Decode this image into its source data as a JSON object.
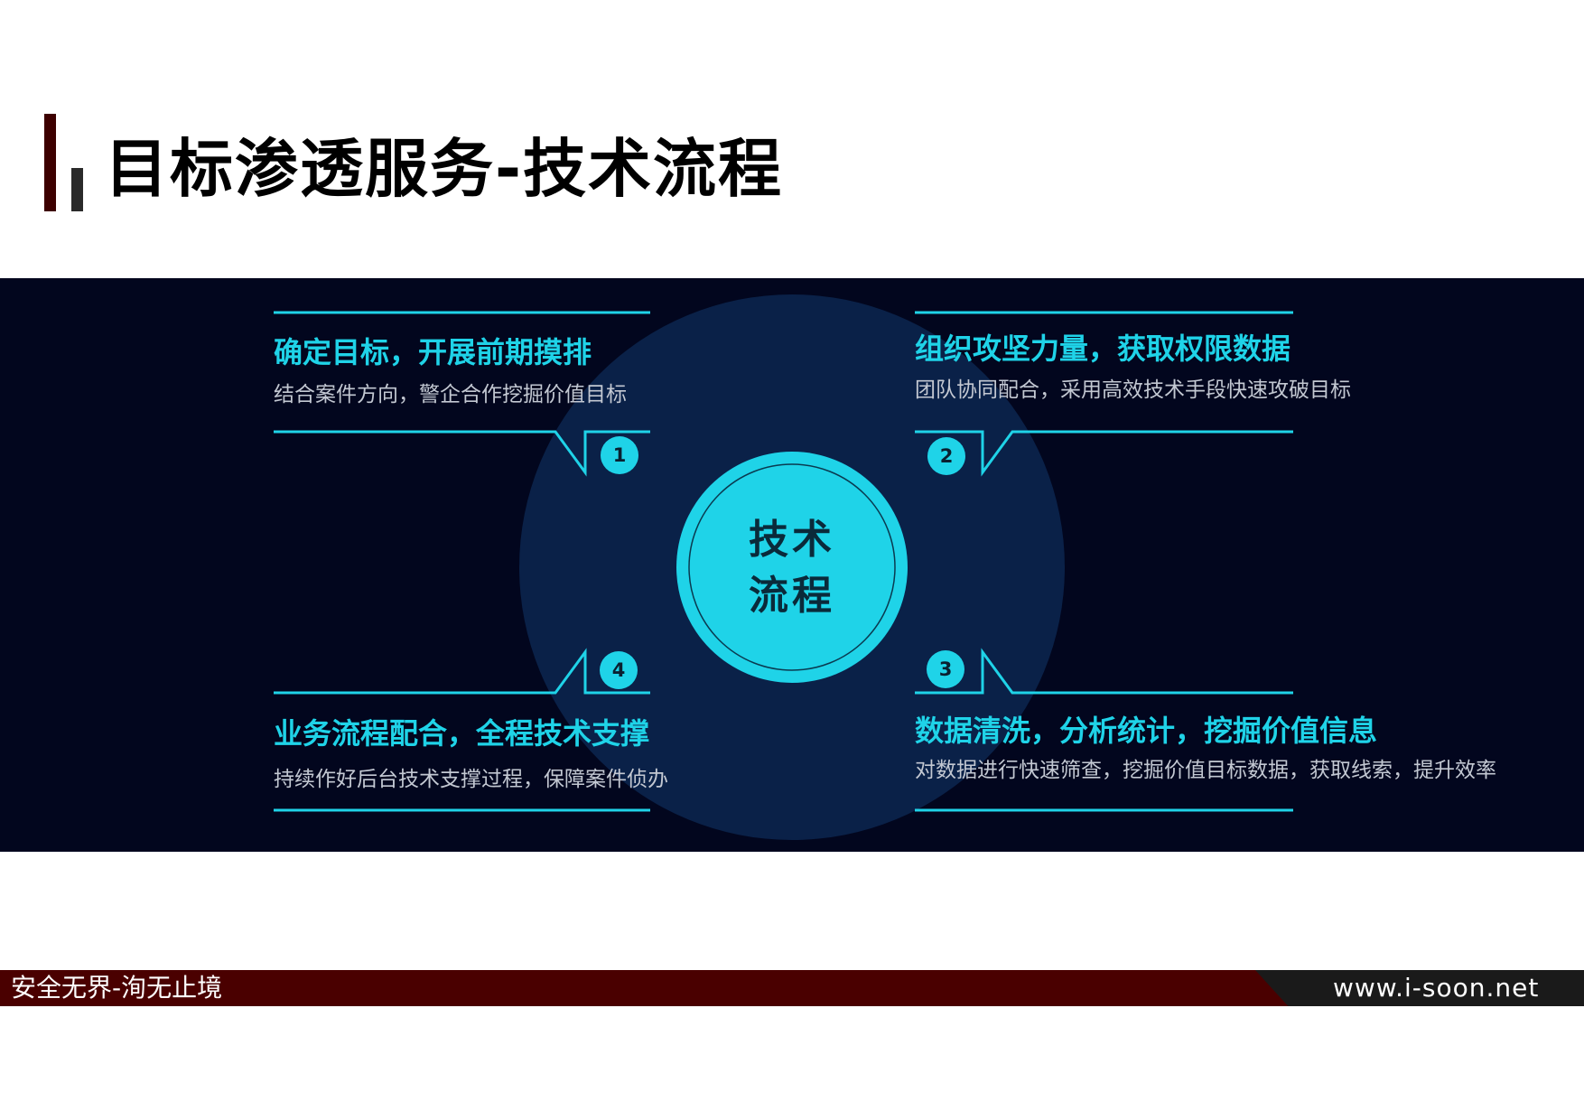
{
  "page": {
    "title": "目标渗透服务-技术流程"
  },
  "center": {
    "line1": "技术",
    "line2": "流程"
  },
  "steps": [
    {
      "number": "1",
      "heading": "确定目标，开展前期摸排",
      "desc": "结合案件方向，警企合作挖掘价值目标"
    },
    {
      "number": "2",
      "heading": "组织攻坚力量，获取权限数据",
      "desc": "团队协同配合，采用高效技术手段快速攻破目标"
    },
    {
      "number": "3",
      "heading": "数据清洗，分析统计，挖掘价值信息",
      "desc": "对数据进行快速筛查，挖掘价值目标数据，获取线索，提升效率"
    },
    {
      "number": "4",
      "heading": "业务流程配合，全程技术支撑",
      "desc": "持续作好后台技术支撑过程，保障案件侦办"
    }
  ],
  "footer": {
    "slogan": "安全无界-洵无止境",
    "url": "www.i-soon.net"
  },
  "colors": {
    "accent": "#1fd3e8",
    "panel": "#02061e",
    "circle": "#0a2148",
    "footer": "#4a0000"
  }
}
